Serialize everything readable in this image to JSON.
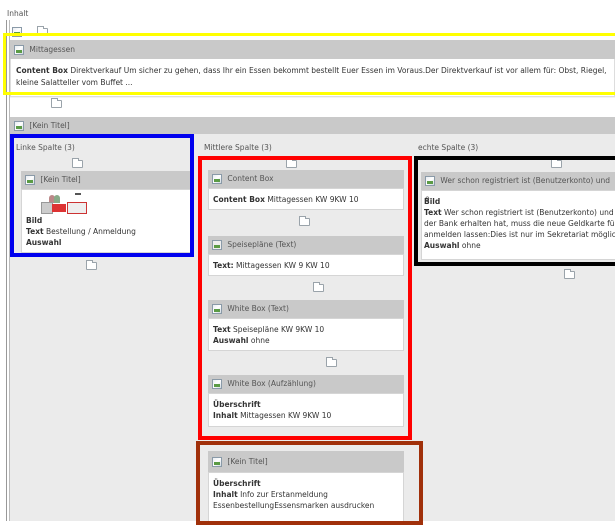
{
  "top": {
    "label": "Inhalt"
  },
  "mittagessen": {
    "title": "Mittagessen",
    "label": "Content Box",
    "text": "Direktverkauf Um sicher zu gehen, dass Ihr ein Essen bekommt bestellt Euer Essen im Voraus.Der Direktverkauf ist vor allem für: Obst, Riegel,",
    "text2": "kleine Salatteller vom Buffet ..."
  },
  "kein_titel": {
    "title": "[Kein Titel]"
  },
  "left": {
    "title": "Linke Spalte (3)",
    "element_title": "[Kein Titel]",
    "bild": "Bild",
    "text_label": "Text",
    "text_value": "Bestellung / Anmeldung",
    "auswahl": "Auswahl"
  },
  "middle": {
    "title": "Mittlere Spalte (3)",
    "e1_title": "Content Box",
    "e1_label": "Content Box",
    "e1_value": "Mittagessen KW 9KW 10",
    "e2_title": "Speisepläne (Text)",
    "e2_label": "Text:",
    "e2_value": "Mittagessen KW 9 KW 10",
    "e3_title": "White Box (Text)",
    "e3_label": "Text",
    "e3_value": "Speisepläne KW 9KW 10",
    "e3_auswahl": "Auswahl",
    "e3_auswahl_value": "ohne",
    "e4_title": "White Box (Aufzählung)",
    "e4_ueber": "Überschrift",
    "e4_label": "Inhalt",
    "e4_value": "Mittagessen KW 9KW 10"
  },
  "right": {
    "title": "echte Spalte (3)",
    "element_title": "Wer schon registriert ist (Benutzerkonto) und e",
    "bild": "Bild",
    "text_label": "Text",
    "line1": "Wer schon registriert ist (Benutzerkonto) und",
    "line2": "der Bank erhalten hat, muss die neue Geldkarte fü",
    "line3": "anmelden lassen:Dies ist nur im Sekretariat möglic",
    "auswahl": "Auswahl",
    "auswahl_value": "ohne"
  },
  "bottom": {
    "title": "[Kein Titel]",
    "ueber": "Überschrift",
    "label": "Inhalt",
    "value": "Info zur Erstanmeldung",
    "value2": "EssenbestellungEssensmarken ausdrucken"
  },
  "colors": {
    "yellow": "#ffff00",
    "blue": "#0000ee",
    "red": "#ff0000",
    "black": "#000000",
    "brown": "#a0300a"
  }
}
